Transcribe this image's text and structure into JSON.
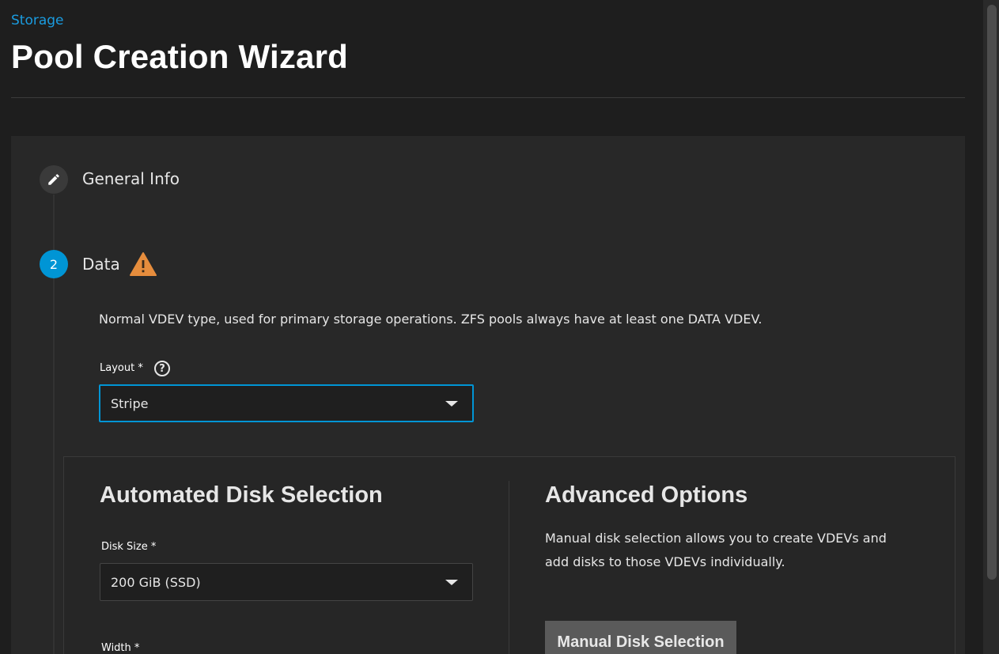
{
  "header": {
    "breadcrumb": "Storage",
    "title": "Pool Creation Wizard"
  },
  "steps": [
    {
      "label": "General Info",
      "icon": "pencil-icon"
    },
    {
      "number": "2",
      "label": "Data",
      "status_icon": "warning-icon"
    }
  ],
  "data_step": {
    "description": "Normal VDEV type, used for primary storage operations. ZFS pools always have at least one DATA VDEV.",
    "layout": {
      "label": "Layout *",
      "value": "Stripe"
    }
  },
  "automated": {
    "title": "Automated Disk Selection",
    "disk_size": {
      "label": "Disk Size *",
      "value": "200 GiB (SSD)"
    },
    "width": {
      "label": "Width *"
    }
  },
  "advanced": {
    "title": "Advanced Options",
    "description": "Manual disk selection allows you to create VDEVs and add disks to those VDEVs individually.",
    "button_label": "Manual Disk Selection"
  },
  "colors": {
    "accent": "#0095d5",
    "warning": "#e68d3d",
    "background": "#1e1e1e",
    "card": "#282828"
  }
}
